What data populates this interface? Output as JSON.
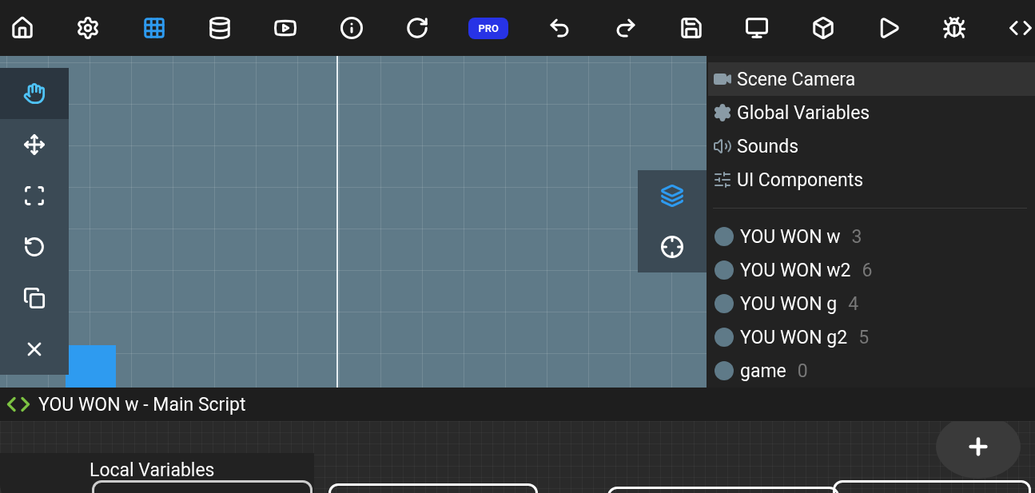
{
  "toolbar": [
    {
      "kind": "icon",
      "selected": false
    },
    {
      "kind": "icon",
      "selected": false
    },
    {
      "kind": "icon",
      "selected": true
    },
    {
      "kind": "icon",
      "selected": false
    },
    {
      "kind": "icon",
      "selected": false
    },
    {
      "kind": "icon",
      "selected": false
    },
    {
      "kind": "icon",
      "selected": false
    },
    {
      "kind": "badge",
      "label": "PRO",
      "selected": false
    },
    {
      "kind": "icon",
      "selected": false
    },
    {
      "kind": "icon",
      "selected": false
    },
    {
      "kind": "icon",
      "selected": false
    },
    {
      "kind": "icon",
      "selected": false
    },
    {
      "kind": "icon",
      "selected": false
    },
    {
      "kind": "icon",
      "selected": false
    },
    {
      "kind": "icon",
      "selected": false
    },
    {
      "kind": "icon",
      "selected": false
    }
  ],
  "tool_palette": [
    {
      "selected": true
    },
    {
      "selected": false
    },
    {
      "selected": false
    },
    {
      "selected": false
    },
    {
      "selected": false
    },
    {
      "selected": false
    }
  ],
  "view_controls": [
    {
      "selected": true
    },
    {
      "selected": false
    }
  ],
  "sidebar": {
    "items": [
      {
        "label": "Scene Camera",
        "selected": true
      },
      {
        "label": "Global Variables",
        "selected": false
      },
      {
        "label": "Sounds",
        "selected": false
      },
      {
        "label": "UI Components",
        "selected": false
      }
    ],
    "objects": [
      {
        "name": "YOU WON w",
        "count": "3",
        "selected": false
      },
      {
        "name": "YOU WON w2",
        "count": "6",
        "selected": false
      },
      {
        "name": "YOU WON g",
        "count": "4",
        "selected": false
      },
      {
        "name": "YOU WON g2",
        "count": "5",
        "selected": false
      },
      {
        "name": "game",
        "count": "0",
        "selected": false
      }
    ]
  },
  "script_bar": {
    "title": "YOU WON w - Main Script"
  },
  "script_area": {
    "panel_title": "Local Variables"
  }
}
